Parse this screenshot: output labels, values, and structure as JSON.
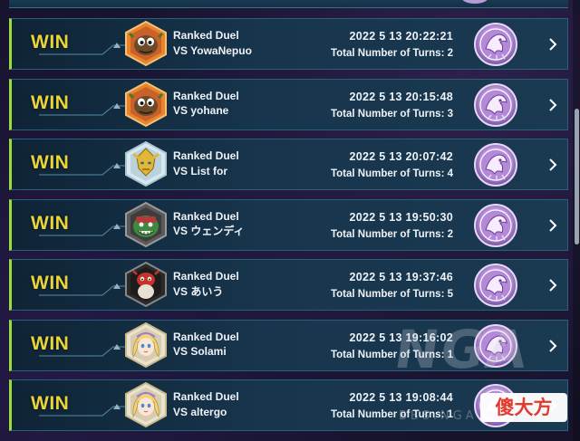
{
  "duel_history": [
    {
      "result": "WIN",
      "mode": "Ranked Duel",
      "opponent": "VS YowaNepuo",
      "datetime": "2022 5 13 20:22:21",
      "turns": "Total Number of Turns: 2",
      "avatar_icon": "kuriboh-avatar"
    },
    {
      "result": "WIN",
      "mode": "Ranked Duel",
      "opponent": "VS yohane",
      "datetime": "2022 5 13 20:15:48",
      "turns": "Total Number of Turns: 3",
      "avatar_icon": "kuriboh-avatar"
    },
    {
      "result": "WIN",
      "mode": "Ranked Duel",
      "opponent": "VS List for",
      "datetime": "2022 5 13 20:07:42",
      "turns": "Total Number of Turns: 4",
      "avatar_icon": "golden-warrior-avatar"
    },
    {
      "result": "WIN",
      "mode": "Ranked Duel",
      "opponent": "VS ウェンディ",
      "datetime": "2022 5 13 19:50:30",
      "turns": "Total Number of Turns: 2",
      "avatar_icon": "green-monster-avatar"
    },
    {
      "result": "WIN",
      "mode": "Ranked Duel",
      "opponent": "VS あいう",
      "datetime": "2022 5 13 19:37:46",
      "turns": "Total Number of Turns: 5",
      "avatar_icon": "red-creature-avatar"
    },
    {
      "result": "WIN",
      "mode": "Ranked Duel",
      "opponent": "VS Solami",
      "datetime": "2022 5 13 19:16:02",
      "turns": "Total Number of Turns: 1",
      "avatar_icon": "blonde-girl-avatar"
    },
    {
      "result": "WIN",
      "mode": "Ranked Duel",
      "opponent": "VS altergo",
      "datetime": "2022 5 13 19:08:44",
      "turns": "Total Number of Turns: 1",
      "avatar_icon": "blonde-girl-avatar"
    }
  ],
  "rank_icon": "pink-dragon-rank-icon",
  "colors": {
    "win_text": "#e9d43a",
    "win_border": "#9bdc3a",
    "row_border": "#2d5f7d",
    "rank_purple": "#c6a3e6"
  },
  "watermark": {
    "logo": "NGA",
    "site": "BBS.NGA.CN",
    "brand": "傻大方"
  }
}
